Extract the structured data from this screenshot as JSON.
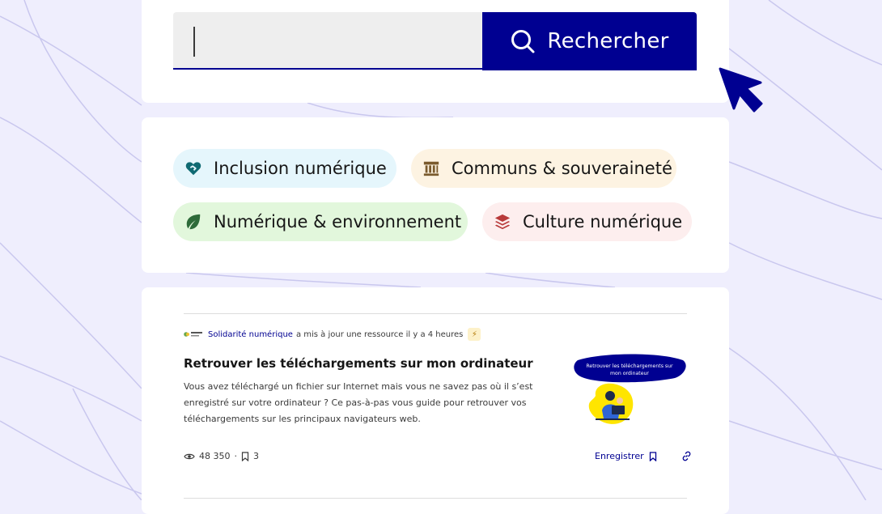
{
  "search": {
    "value": "",
    "button_label": "Rechercher"
  },
  "themes": [
    {
      "label": "Inclusion numérique",
      "icon": "heart-handshake-icon",
      "color": "#0f6a72"
    },
    {
      "label": "Communs & souveraineté",
      "icon": "bank-icon",
      "color": "#7a5a2d"
    },
    {
      "label": "Numérique & environnement",
      "icon": "leaf-icon",
      "color": "#2e6b3a"
    },
    {
      "label": "Culture numérique",
      "icon": "stack-icon",
      "color": "#b83a3a"
    }
  ],
  "resource": {
    "author": "Solidarité numérique",
    "activity": "a mis à jour une ressource il y a 4 heures",
    "badge_icon": "bolt-icon",
    "title": "Retrouver les téléchargements sur mon ordinateur",
    "description": "Vous avez téléchargé un fichier sur Internet mais vous ne savez pas où il s’est enregistré sur votre ordinateur ? Ce pas-à-pas vous guide pour retrouver vos téléchargements sur les principaux navigateurs web.",
    "thumbnail_text_line1": "Retrouver les téléchargements sur",
    "thumbnail_text_line2": "mon ordinateur",
    "views": "48 350",
    "separator": "·",
    "saves": "3",
    "save_label": "Enregistrer"
  },
  "colors": {
    "primary": "#000091",
    "background": "#efeefd"
  }
}
